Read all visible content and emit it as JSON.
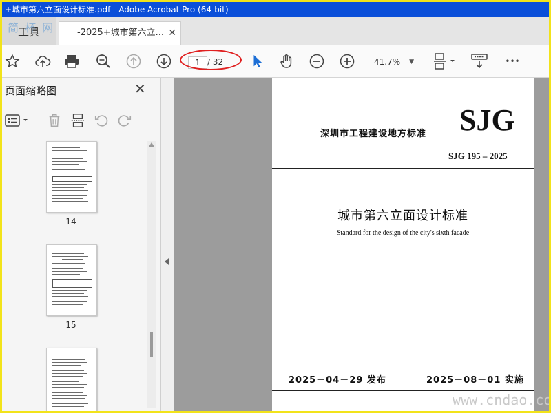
{
  "window": {
    "title": "+城市第六立面设计标准.pdf - Adobe Acrobat Pro (64-bit)"
  },
  "tabs": {
    "tools_label": "工具",
    "doc_tab_label": "-2025+城市第六立...",
    "close_glyph": "✕",
    "watermark_top": "简 杯 网"
  },
  "toolbar": {
    "page_current": "1",
    "page_total": "/ 32",
    "zoom": "41.7%",
    "more_glyph": "•••"
  },
  "left_pane": {
    "title": "页面缩略图",
    "close_glyph": "✕",
    "thumbnails": [
      {
        "page_number": "14"
      },
      {
        "page_number": "15"
      }
    ]
  },
  "document": {
    "header_cn": "深圳市工程建设地方标准",
    "logo": "SJG",
    "code": "SJG 195  – 2025",
    "title_cn": "城市第六立面设计标准",
    "title_en": "Standard for the design of the city's sixth facade",
    "publish": "2025－04－29  发布",
    "effective": "2025－08－01  实施"
  },
  "watermark": "www.cndao.com"
}
